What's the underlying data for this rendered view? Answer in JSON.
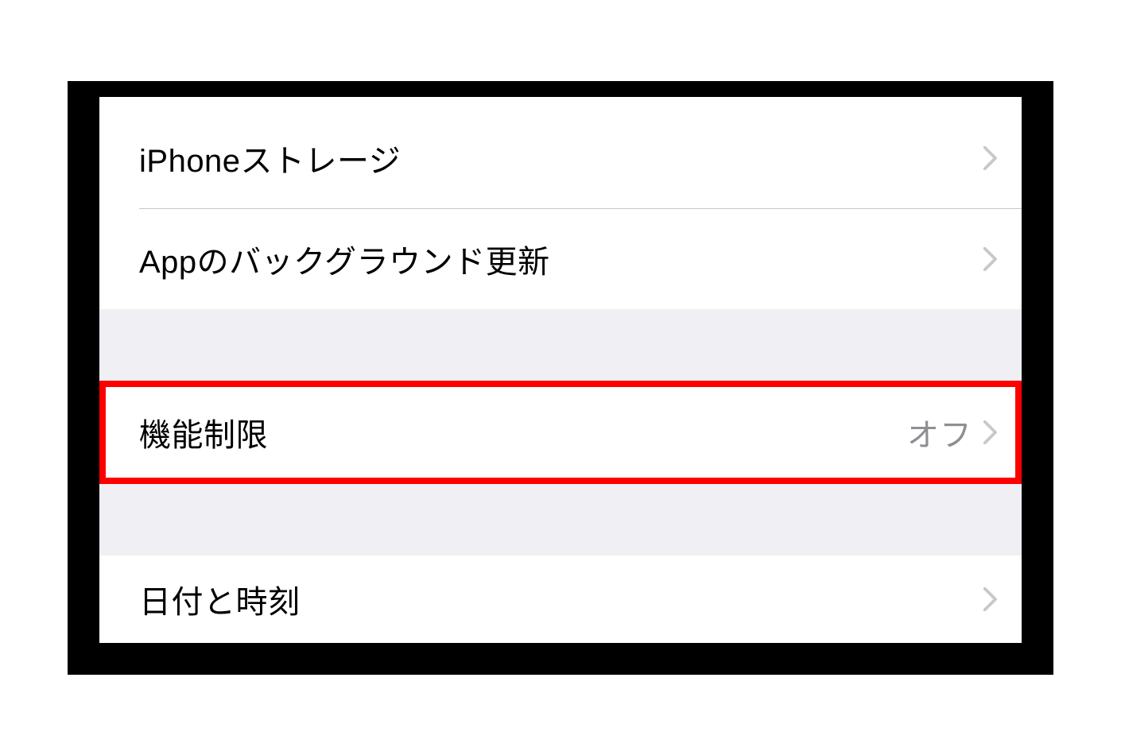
{
  "settings": {
    "group1": {
      "storage": {
        "label": "iPhoneストレージ"
      },
      "backgroundRefresh": {
        "label": "Appのバックグラウンド更新"
      }
    },
    "group2": {
      "restrictions": {
        "label": "機能制限",
        "value": "オフ"
      }
    },
    "group3": {
      "dateTime": {
        "label": "日付と時刻"
      }
    }
  },
  "colors": {
    "highlight": "#ff0000",
    "separator": "#c8c7cc",
    "groupBg": "#efeff4",
    "valueText": "#8e8e93"
  }
}
